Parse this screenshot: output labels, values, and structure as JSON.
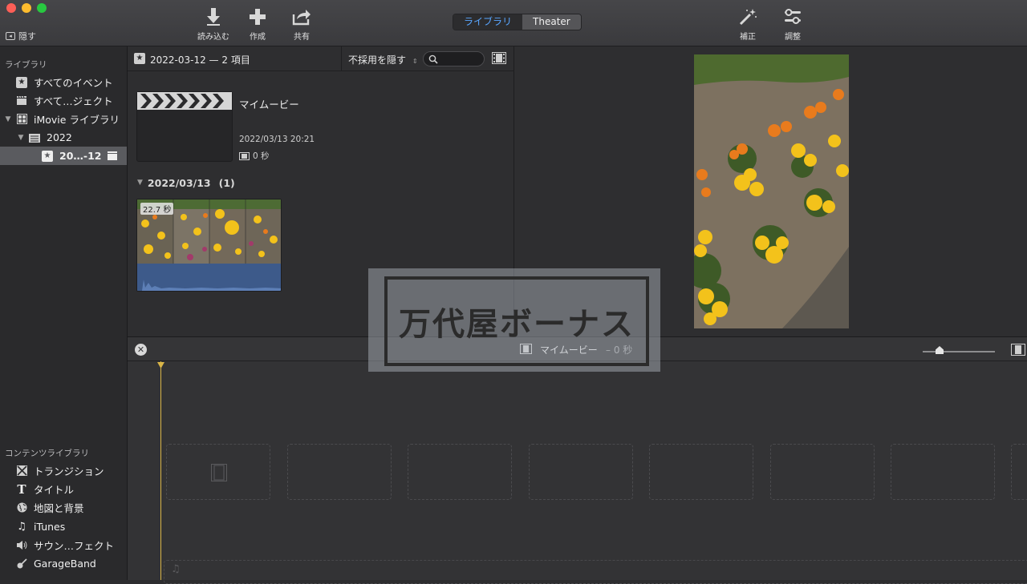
{
  "toolbar": {
    "hide_label": "隠す",
    "import_label": "読み込む",
    "create_label": "作成",
    "share_label": "共有",
    "view_tabs": [
      "ライブラリ",
      "Theater"
    ],
    "enhance_label": "補正",
    "adjust_label": "調整"
  },
  "sidebar": {
    "libraries_title": "ライブラリ",
    "items": [
      {
        "label": "すべてのイベント",
        "icon": "star-icon"
      },
      {
        "label": "すべて…ジェクト",
        "icon": "clapper-icon"
      },
      {
        "label": "iMovie ライブラリ",
        "icon": "grid-icon"
      },
      {
        "label": "2022",
        "icon": "folder-icon"
      },
      {
        "label": "20…-12",
        "icon": "star-icon"
      }
    ],
    "content_title": "コンテンツライブラリ",
    "content_items": [
      {
        "label": "トランジション",
        "icon": "transition-icon"
      },
      {
        "label": "タイトル",
        "icon": "title-icon"
      },
      {
        "label": "地図と背景",
        "icon": "globe-icon"
      },
      {
        "label": "iTunes",
        "icon": "music-note-icon"
      },
      {
        "label": "サウン…フェクト",
        "icon": "speaker-icon"
      },
      {
        "label": "GarageBand",
        "icon": "guitar-icon"
      }
    ]
  },
  "browser": {
    "header_title": "2022-03-12 — 2 項目",
    "filter_label": "不採用を隠す",
    "project": {
      "title": "マイムービー",
      "date": "2022/03/13 20:21",
      "duration": "0 秒"
    },
    "group_label": "2022/03/13",
    "group_count": "(1)",
    "clip_duration": "22.7 秒"
  },
  "timeline": {
    "project_name": "マイムービー",
    "duration": "– 0 秒"
  },
  "watermark": {
    "text": "万代屋ボーナス"
  },
  "colors": {
    "accent": "#59a6ff",
    "playhead": "#d9b548",
    "flower_yellow": "#f3c21b",
    "flower_orange": "#e87b1d"
  }
}
